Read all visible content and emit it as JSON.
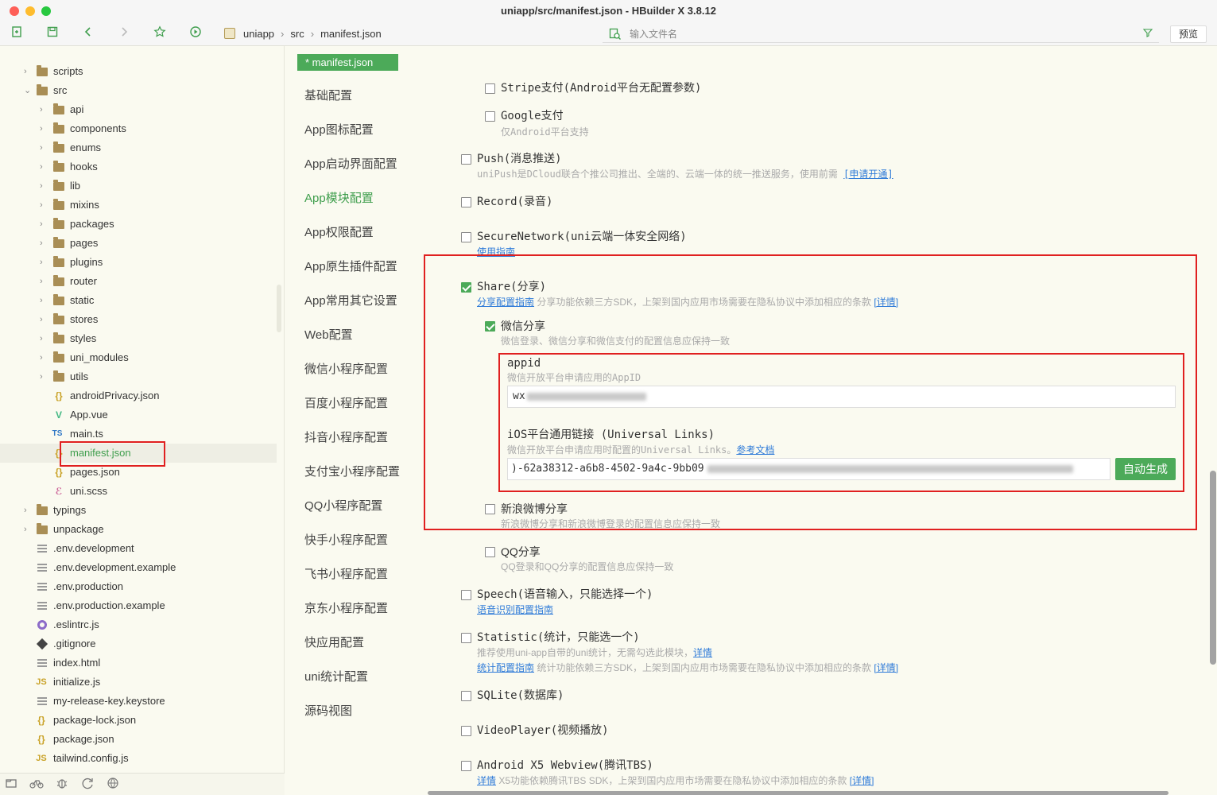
{
  "window": {
    "title": "uniapp/src/manifest.json - HBuilder X 3.8.12"
  },
  "colors": {
    "accent": "#4caa59",
    "highlight": "#e02020",
    "link": "#2f7bd8"
  },
  "toolbar": {
    "breadcrumbs": [
      "uniapp",
      "src",
      "manifest.json"
    ],
    "search_placeholder": "输入文件名",
    "preview_label": "预览"
  },
  "tree": {
    "folders_top": [
      "scripts",
      "src"
    ],
    "src_children": [
      "api",
      "components",
      "enums",
      "hooks",
      "lib",
      "mixins",
      "packages",
      "pages",
      "plugins",
      "router",
      "static",
      "stores",
      "styles",
      "uni_modules",
      "utils"
    ],
    "src_files": [
      "androidPrivacy.json",
      "App.vue",
      "main.ts",
      "manifest.json",
      "pages.json",
      "uni.scss"
    ],
    "root_folders": [
      "typings",
      "unpackage"
    ],
    "root_files": [
      ".env.development",
      ".env.development.example",
      ".env.production",
      ".env.production.example",
      ".eslintrc.js",
      ".gitignore",
      "index.html",
      "initialize.js",
      "my-release-key.keystore",
      "package-lock.json",
      "package.json",
      "tailwind.config.js"
    ],
    "file_badges": {
      "json": "{}",
      "vue": "V",
      "ts": "TS",
      "js": "JS"
    }
  },
  "editor": {
    "tab_label": "* manifest.json"
  },
  "config_nav": [
    "基础配置",
    "App图标配置",
    "App启动界面配置",
    "App模块配置",
    "App权限配置",
    "App原生插件配置",
    "App常用其它设置",
    "Web配置",
    "微信小程序配置",
    "百度小程序配置",
    "抖音小程序配置",
    "支付宝小程序配置",
    "QQ小程序配置",
    "快手小程序配置",
    "飞书小程序配置",
    "京东小程序配置",
    "快应用配置",
    "uni统计配置",
    "源码视图"
  ],
  "modules": {
    "stripe": "Stripe支付(Android平台无配置参数)",
    "google": "Google支付",
    "google_desc": "仅Android平台支持",
    "push": "Push(消息推送)",
    "push_desc": "uniPush是DCloud联合个推公司推出、全端的、云端一体的统一推送服务，使用前需",
    "push_link": "[申请开通]",
    "record": "Record(录音)",
    "securenetwork": "SecureNetwork(uni云端一体安全网络)",
    "securenetwork_link": "使用指南",
    "share": "Share(分享)",
    "share_guide": "分享配置指南",
    "share_desc": "分享功能依赖三方SDK，上架到国内应用市场需要在隐私协议中添加相应的条款",
    "share_detail": "[详情]",
    "wechat": "微信分享",
    "wechat_desc": "微信登录、微信分享和微信支付的配置信息应保持一致",
    "appid_label": "appid",
    "appid_desc": "微信开放平台申请应用的AppID",
    "appid_value": "wx",
    "ul_label": "iOS平台通用链接 (Universal Links)",
    "ul_desc": "微信开放平台申请应用时配置的Universal Links。",
    "ul_doc": "参考文档",
    "ul_value": ")-62a38312-a6b8-4502-9a4c-9bb09",
    "auto_gen": "自动生成",
    "weibo": "新浪微博分享",
    "weibo_desc": "新浪微博分享和新浪微博登录的配置信息应保持一致",
    "qq": "QQ分享",
    "qq_desc": "QQ登录和QQ分享的配置信息应保持一致",
    "speech": "Speech(语音输入，只能选择一个)",
    "speech_link": "语音识别配置指南",
    "statistic": "Statistic(统计，只能选一个)",
    "statistic_desc": "推荐使用uni-app自带的uni统计，无需勾选此模块，",
    "statistic_detail": "详情",
    "statistic_guide": "统计配置指南",
    "statistic_desc2": "统计功能依赖三方SDK，上架到国内应用市场需要在隐私协议中添加相应的条款",
    "statistic_detail2": "[详情]",
    "sqlite": "SQLite(数据库)",
    "videoplayer": "VideoPlayer(视频播放)",
    "x5": "Android X5 Webview(腾讯TBS)",
    "x5_link": "详情",
    "x5_desc": "X5功能依赖腾讯TBS SDK，上架到国内应用市场需要在隐私协议中添加相应的条款",
    "x5_detail": "[详情]"
  }
}
